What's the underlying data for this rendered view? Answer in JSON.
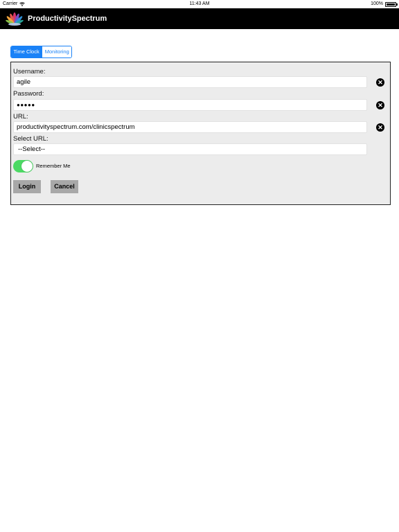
{
  "status_bar": {
    "carrier": "Carrier",
    "time": "11:43 AM",
    "battery": "100%",
    "wifi_icon": "wifi-icon",
    "battery_icon": "battery-icon"
  },
  "nav": {
    "logo_icon": "lotus-logo",
    "title": "ProductivitySpectrum"
  },
  "segments": {
    "time_clock": "Time Clock",
    "monitoring": "Monitoring",
    "selected": "Time Clock"
  },
  "form": {
    "username_label": "Username:",
    "username_value": "agile",
    "password_label": "Password:",
    "password_value": "●●●●●",
    "url_label": "URL:",
    "url_value": "productivityspectrum.com/clinicspectrum",
    "select_url_label": "Select URL:",
    "select_url_value": "--Select--",
    "remember_me_label": "Remember Me",
    "remember_me_on": true,
    "login_label": "Login",
    "cancel_label": "Cancel",
    "clear_icon": "clear-circle-icon"
  },
  "colors": {
    "accent": "#1a82f7",
    "toggle_on": "#4cd964",
    "nav_bg": "#000000",
    "panel_bg": "#ececec",
    "button_bg": "#a8a8a8"
  }
}
